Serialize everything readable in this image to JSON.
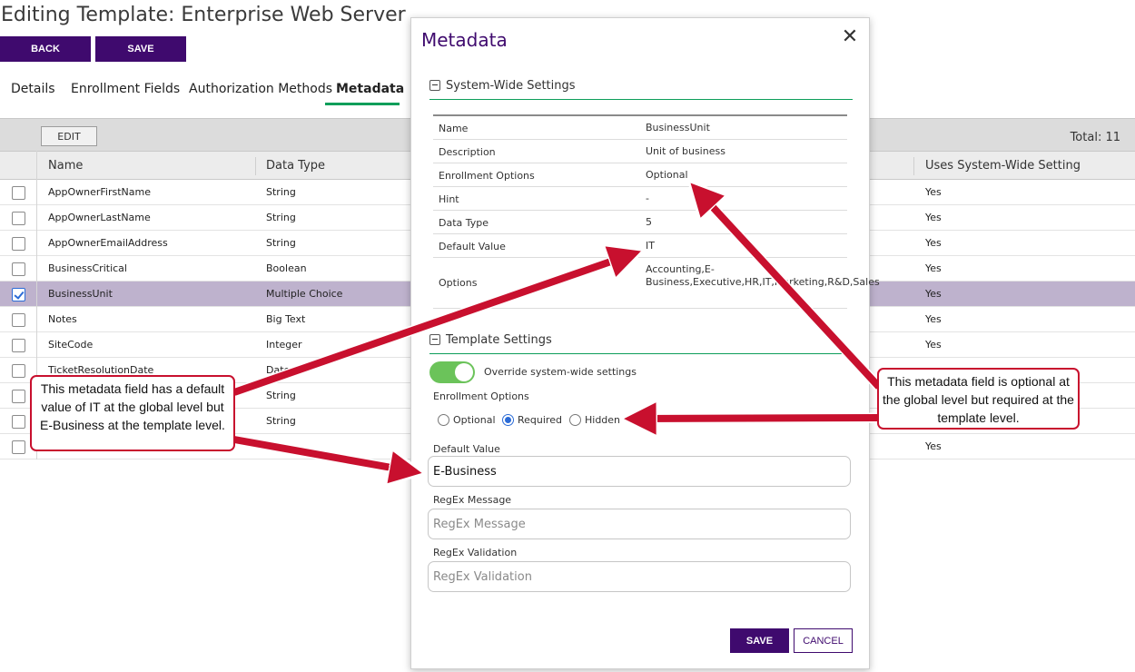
{
  "page": {
    "title": "Editing Template: Enterprise Web Server",
    "back_label": "BACK",
    "save_label": "SAVE",
    "tabs": [
      "Details",
      "Enrollment Fields",
      "Authorization Methods",
      "Metadata"
    ],
    "active_tab": "Metadata"
  },
  "grid": {
    "edit_label": "EDIT",
    "total": "Total: 11",
    "headers": {
      "name": "Name",
      "data_type": "Data Type",
      "uses_system_wide": "Uses System-Wide Setting"
    },
    "rows": [
      {
        "name": "AppOwnerFirstName",
        "type": "String",
        "uses": "Yes",
        "checked": false
      },
      {
        "name": "AppOwnerLastName",
        "type": "String",
        "uses": "Yes",
        "checked": false
      },
      {
        "name": "AppOwnerEmailAddress",
        "type": "String",
        "uses": "Yes",
        "checked": false
      },
      {
        "name": "BusinessCritical",
        "type": "Boolean",
        "uses": "Yes",
        "checked": false
      },
      {
        "name": "BusinessUnit",
        "type": "Multiple Choice",
        "uses": "Yes",
        "checked": true
      },
      {
        "name": "Notes",
        "type": "Big Text",
        "uses": "Yes",
        "checked": false
      },
      {
        "name": "SiteCode",
        "type": "Integer",
        "uses": "Yes",
        "checked": false
      },
      {
        "name": "TicketResolutionDate",
        "type": "Date",
        "uses": "",
        "checked": false
      },
      {
        "name": "",
        "type": "String",
        "uses": "",
        "checked": false
      },
      {
        "name": "",
        "type": "String",
        "uses": "",
        "checked": false
      },
      {
        "name": "",
        "type": "",
        "uses": "Yes",
        "checked": false
      }
    ]
  },
  "modal": {
    "title": "Metadata",
    "close_icon": "close-icon",
    "system_section": "System-Wide Settings",
    "system_rows": [
      {
        "key": "Name",
        "value": "BusinessUnit"
      },
      {
        "key": "Description",
        "value": "Unit of business"
      },
      {
        "key": "Enrollment Options",
        "value": "Optional"
      },
      {
        "key": "Hint",
        "value": "-"
      },
      {
        "key": "Data Type",
        "value": "5"
      },
      {
        "key": "Default Value",
        "value": "IT"
      },
      {
        "key": "Options",
        "value": "Accounting,E-Business,Executive,HR,IT,Marketing,R&D,Sales"
      }
    ],
    "template_section": "Template Settings",
    "override_label": "Override system-wide settings",
    "override_on": true,
    "enrollment_label": "Enrollment Options",
    "radio_options": [
      "Optional",
      "Required",
      "Hidden"
    ],
    "radio_selected": "Required",
    "default_value_label": "Default Value",
    "default_value": "E-Business",
    "regex_message_label": "RegEx Message",
    "regex_message_placeholder": "RegEx Message",
    "regex_validation_label": "RegEx Validation",
    "regex_validation_placeholder": "RegEx Validation",
    "save_label": "SAVE",
    "cancel_label": "CANCEL"
  },
  "callouts": {
    "left": "This metadata field has a default value of IT at the global level but E-Business at the template level.",
    "right": "This metadata field is optional at the global level but required at the template level."
  },
  "colors": {
    "brand_purple": "#3f0a6e",
    "accent_green": "#0d9e5a",
    "annotation_red": "#c8102e",
    "selected_row": "#beb2cd"
  }
}
